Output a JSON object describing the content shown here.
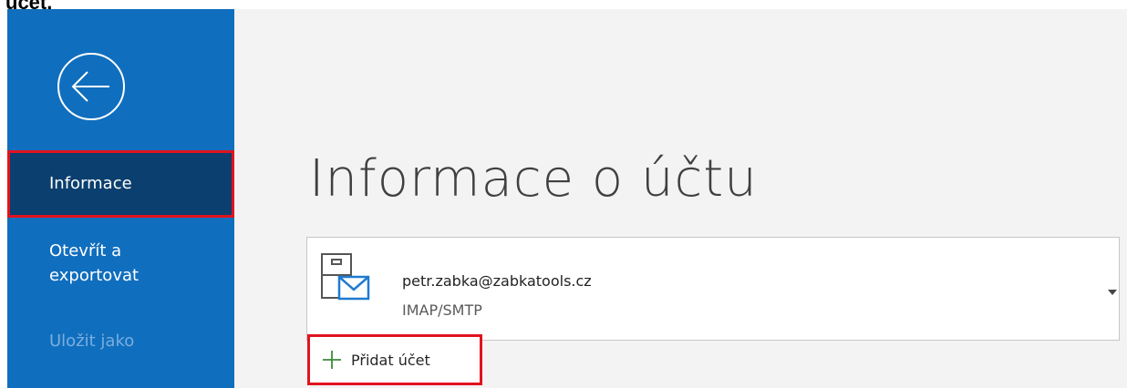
{
  "top_fragment": "účet.",
  "sidebar": {
    "back_icon": "arrow-left-circle-icon",
    "items": [
      {
        "label": "Informace",
        "selected": true
      },
      {
        "label_line1": "Otevřít a",
        "label_line2": "exportovat"
      },
      {
        "label": "Uložit jako",
        "dimmed": true
      }
    ]
  },
  "main": {
    "title": "Informace o účtu",
    "account": {
      "icon": "mailbox-icon",
      "email": "petr.zabka@zabkatools.cz",
      "type": "IMAP/SMTP",
      "dropdown_icon": "caret-down-icon"
    },
    "add_account": {
      "icon": "plus-icon",
      "label": "Přidat účet"
    }
  },
  "colors": {
    "sidebar_bg": "#106ebe",
    "selected_bg": "#0b3f6f",
    "highlight_border": "#e0141e",
    "plus_green": "#3c8a3c"
  }
}
